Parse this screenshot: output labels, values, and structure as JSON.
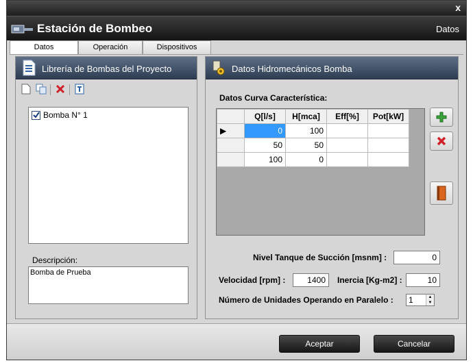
{
  "window": {
    "close_glyph": "x"
  },
  "header": {
    "title": "Estación de Bombeo",
    "right_label": "Datos",
    "icon": "pump-station-icon"
  },
  "tabs": [
    {
      "label": "Datos",
      "active": true
    },
    {
      "label": "Operación",
      "active": false
    },
    {
      "label": "Dispositivos",
      "active": false
    }
  ],
  "library": {
    "title": "Librería de Bombas del Proyecto",
    "icon": "document-list-icon",
    "toolbar": [
      "new-file-icon",
      "copy-icon",
      "delete-icon",
      "export-icon"
    ],
    "items": [
      {
        "label": "Bomba N° 1",
        "checked": true
      }
    ],
    "description_label": "Descripción:",
    "description_value": "Bomba de Prueba"
  },
  "hydro": {
    "title": "Datos Hidromecánicos Bomba",
    "icon": "pump-gear-icon",
    "curve_label": "Datos Curva Característica:",
    "columns": [
      "Q[l/s]",
      "H[mca]",
      "Eff[%]",
      "Pot[kW]"
    ],
    "rows": [
      [
        "0",
        "100",
        "",
        ""
      ],
      [
        "50",
        "50",
        "",
        ""
      ],
      [
        "100",
        "0",
        "",
        ""
      ]
    ],
    "buttons": [
      "add-icon",
      "delete-icon",
      "book-icon"
    ],
    "nivel_label": "Nivel Tanque de Succión [msnm] :",
    "nivel_value": "0",
    "velocidad_label": "Velocidad [rpm] :",
    "velocidad_value": "1400",
    "inercia_label": "Inercia [Kg-m2] :",
    "inercia_value": "10",
    "unidades_label": "Número de Unidades Operando en Paralelo :",
    "unidades_value": "1"
  },
  "footer": {
    "accept": "Aceptar",
    "cancel": "Cancelar"
  },
  "colors": {
    "selection": "#3399ff",
    "panel_header": "#3f4f66",
    "header_bar": "#1e1e1e"
  }
}
